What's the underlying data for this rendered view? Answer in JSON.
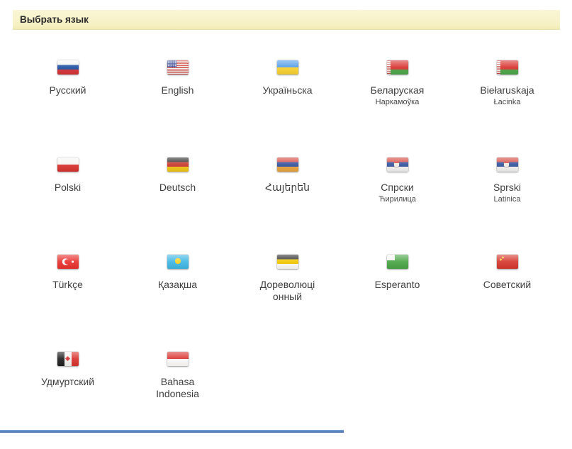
{
  "header": {
    "title": "Выбрать язык"
  },
  "colors": {
    "header_bg": "#f6f1c3",
    "header_text": "#2b2b2b",
    "label_text": "#3f3f3f",
    "page_bg": "#ffffff",
    "bottom_bar": "#3c67a6"
  },
  "languages": [
    {
      "label": "Русский",
      "sublabel": "",
      "flag": "russia-flag-icon"
    },
    {
      "label": "English",
      "sublabel": "",
      "flag": "usa-flag-icon"
    },
    {
      "label": "Україньска",
      "sublabel": "",
      "flag": "ukraine-flag-icon"
    },
    {
      "label": "Беларуская",
      "sublabel": "Наркамоўка",
      "flag": "belarus-flag-icon"
    },
    {
      "label": "Biełaruskaja",
      "sublabel": "Łacinka",
      "flag": "belarus-flag-icon"
    },
    {
      "label": "Polski",
      "sublabel": "",
      "flag": "poland-flag-icon"
    },
    {
      "label": "Deutsch",
      "sublabel": "",
      "flag": "germany-flag-icon"
    },
    {
      "label": "Հայերեն",
      "sublabel": "",
      "flag": "armenia-flag-icon"
    },
    {
      "label": "Спрски",
      "sublabel": "Ћирилица",
      "flag": "serbia-flag-icon"
    },
    {
      "label": "Sprski",
      "sublabel": "Latinica",
      "flag": "serbia-flag-icon"
    },
    {
      "label": "Türkçe",
      "sublabel": "",
      "flag": "turkey-flag-icon"
    },
    {
      "label": "Қазақша",
      "sublabel": "",
      "flag": "kazakhstan-flag-icon"
    },
    {
      "label": "Дореволюці\nонный",
      "sublabel": "",
      "flag": "russian-empire-flag-icon"
    },
    {
      "label": "Esperanto",
      "sublabel": "",
      "flag": "esperanto-flag-icon"
    },
    {
      "label": "Советский",
      "sublabel": "",
      "flag": "soviet-flag-icon"
    },
    {
      "label": "Удмуртский",
      "sublabel": "",
      "flag": "udmurtia-flag-icon"
    },
    {
      "label": "Bahasa\nIndonesia",
      "sublabel": "",
      "flag": "indonesia-flag-icon"
    }
  ]
}
